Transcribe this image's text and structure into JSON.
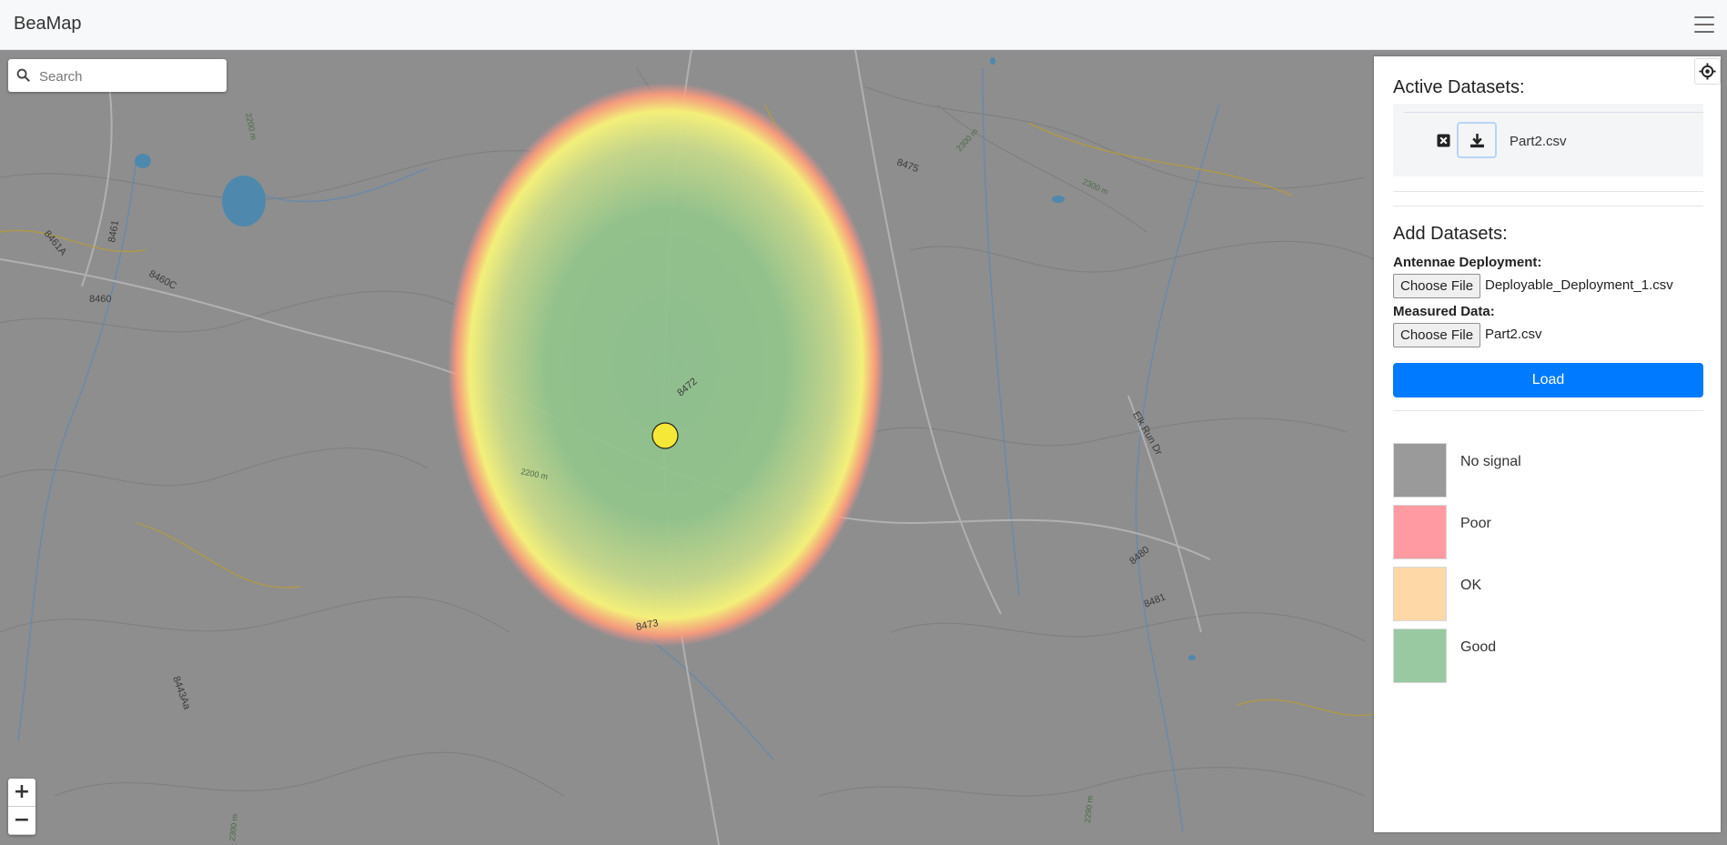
{
  "app": {
    "title": "BeaMap"
  },
  "search": {
    "placeholder": "Search"
  },
  "zoom": {
    "in_label": "+",
    "out_label": "−"
  },
  "map": {
    "road_labels": [
      "8475",
      "8472",
      "8473",
      "8461A",
      "8461",
      "8460C",
      "8460",
      "8480",
      "8481",
      "8443Aa",
      "Elk Run Dr"
    ],
    "contour_labels": [
      "2200 m",
      "2300 m",
      "2200 m",
      "2300 m",
      "2290 m",
      "2300 m"
    ]
  },
  "active": {
    "heading": "Active Datasets:",
    "datasets": [
      {
        "name": "Part2.csv"
      }
    ]
  },
  "add": {
    "heading": "Add Datasets:",
    "antenna": {
      "label": "Antennae Deployment:",
      "button": "Choose File",
      "file": "Deployable_Deployment_1.csv"
    },
    "measured": {
      "label": "Measured Data:",
      "button": "Choose File",
      "file": "Part2.csv"
    },
    "load_label": "Load"
  },
  "legend": [
    {
      "label": "No signal",
      "color": "#9a9a9a"
    },
    {
      "label": "Poor",
      "color": "#ff9aa2"
    },
    {
      "label": "OK",
      "color": "#ffd8a8"
    },
    {
      "label": "Good",
      "color": "#99c9a0"
    }
  ],
  "colors": {
    "accent": "#007bff",
    "marker": "#f5e836"
  },
  "icons": [
    "hamburger-icon",
    "search-icon",
    "locate-icon",
    "close-box-icon",
    "download-icon"
  ]
}
